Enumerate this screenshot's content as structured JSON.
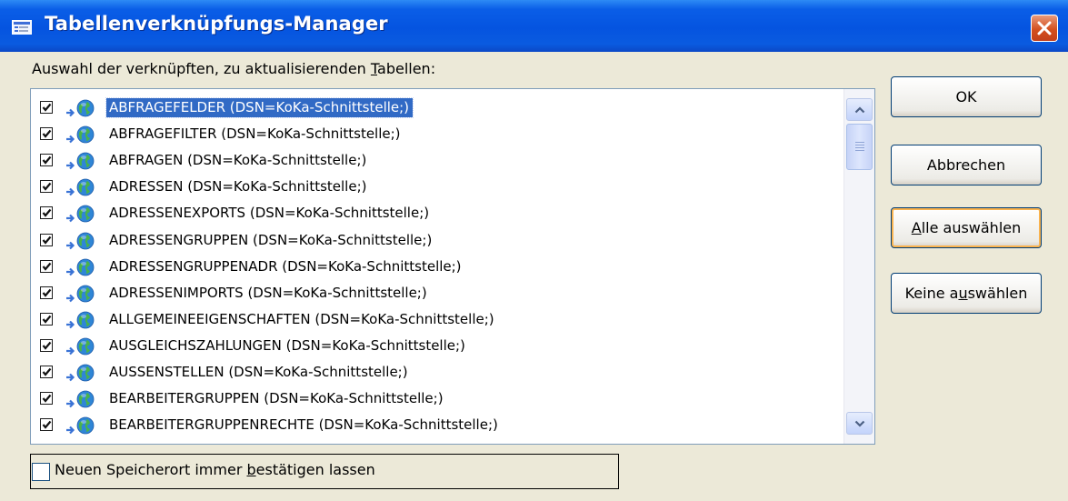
{
  "window": {
    "title": "Tabellenverknüpfungs-Manager",
    "close_label": "✕"
  },
  "list_label": {
    "before": "Auswahl der verknüpften, zu aktualisierenden ",
    "mnemonic": "T",
    "after": "abellen:"
  },
  "tables": [
    {
      "text": "ABFRAGEFELDER   (DSN=KoKa-Schnittstelle;)",
      "checked": true,
      "selected": true
    },
    {
      "text": "ABFRAGEFILTER   (DSN=KoKa-Schnittstelle;)",
      "checked": true,
      "selected": false
    },
    {
      "text": "ABFRAGEN   (DSN=KoKa-Schnittstelle;)",
      "checked": true,
      "selected": false
    },
    {
      "text": "ADRESSEN   (DSN=KoKa-Schnittstelle;)",
      "checked": true,
      "selected": false
    },
    {
      "text": "ADRESSENEXPORTS   (DSN=KoKa-Schnittstelle;)",
      "checked": true,
      "selected": false
    },
    {
      "text": "ADRESSENGRUPPEN   (DSN=KoKa-Schnittstelle;)",
      "checked": true,
      "selected": false
    },
    {
      "text": "ADRESSENGRUPPENADR   (DSN=KoKa-Schnittstelle;)",
      "checked": true,
      "selected": false
    },
    {
      "text": "ADRESSENIMPORTS   (DSN=KoKa-Schnittstelle;)",
      "checked": true,
      "selected": false
    },
    {
      "text": "ALLGEMEINEEIGENSCHAFTEN   (DSN=KoKa-Schnittstelle;)",
      "checked": true,
      "selected": false
    },
    {
      "text": "AUSGLEICHSZAHLUNGEN   (DSN=KoKa-Schnittstelle;)",
      "checked": true,
      "selected": false
    },
    {
      "text": "AUSSENSTELLEN   (DSN=KoKa-Schnittstelle;)",
      "checked": true,
      "selected": false
    },
    {
      "text": "BEARBEITERGRUPPEN   (DSN=KoKa-Schnittstelle;)",
      "checked": true,
      "selected": false
    },
    {
      "text": "BEARBEITERGRUPPENRECHTE   (DSN=KoKa-Schnittstelle;)",
      "checked": true,
      "selected": false
    }
  ],
  "buttons": {
    "ok": {
      "before": "OK",
      "mnemonic": "",
      "after": ""
    },
    "cancel": {
      "before": "Abbrechen",
      "mnemonic": "",
      "after": ""
    },
    "select_all": {
      "before": "",
      "mnemonic": "A",
      "after": "lle auswählen"
    },
    "select_none": {
      "before": "Keine a",
      "mnemonic": "u",
      "after": "swählen"
    }
  },
  "option": {
    "before": "Neuen Speicherort immer ",
    "mnemonic": "b",
    "after": "estätigen lassen",
    "checked": false
  },
  "colors": {
    "titlebar": "#0554e0",
    "selection": "#316ac5",
    "dialog_background": "#ece9d8",
    "focus_outline": "#f9b34f"
  },
  "icons": {
    "title": "dialog-icon",
    "row_link": "arrow-icon",
    "row_source": "globe-icon",
    "scroll_up": "chevron-up-icon",
    "scroll_down": "chevron-down-icon"
  }
}
